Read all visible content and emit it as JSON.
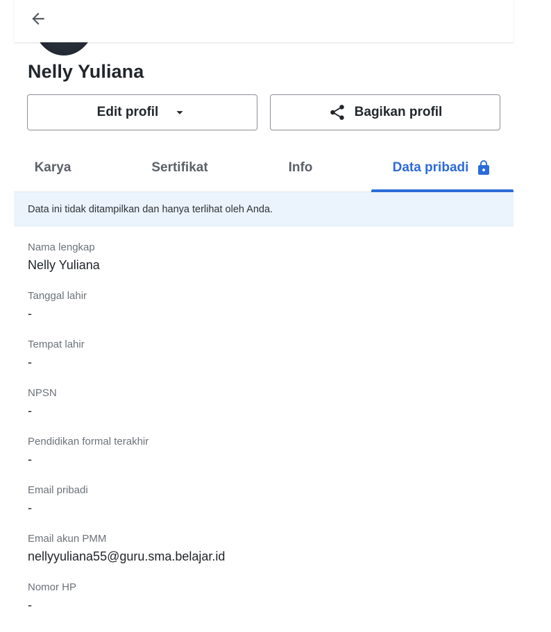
{
  "profile": {
    "name": "Nelly Yuliana",
    "edit_label": "Edit profil",
    "share_label": "Bagikan profil"
  },
  "tabs": [
    {
      "label": "Karya"
    },
    {
      "label": "Sertifikat"
    },
    {
      "label": "Info"
    },
    {
      "label": "Data pribadi",
      "active": true,
      "icon": "lock-icon"
    }
  ],
  "notice": "Data ini tidak ditampilkan dan hanya terlihat oleh Anda.",
  "fields": [
    {
      "label": "Nama lengkap",
      "value": "Nelly Yuliana"
    },
    {
      "label": "Tanggal lahir",
      "value": "-"
    },
    {
      "label": "Tempat lahir",
      "value": "-"
    },
    {
      "label": "NPSN",
      "value": "-"
    },
    {
      "label": "Pendidikan formal terakhir",
      "value": "-"
    },
    {
      "label": "Email pribadi",
      "value": "-"
    },
    {
      "label": "Email akun PMM",
      "value": "nellyyuliana55@guru.sma.belajar.id"
    },
    {
      "label": "Nomor HP",
      "value": "-"
    }
  ],
  "colors": {
    "accent": "#2c6bd9",
    "notice_bg": "#ebf3fd",
    "text": "#1f2328",
    "muted": "#6c7178"
  }
}
